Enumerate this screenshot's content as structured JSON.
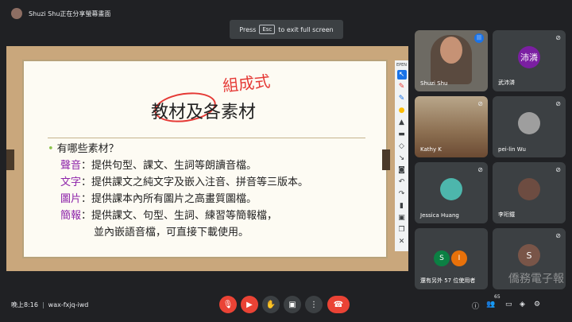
{
  "topbar": {
    "presenting_text": "Shuzi Shu正在分享螢幕畫面"
  },
  "fullscreen_toast": {
    "before": "Press",
    "key": "Esc",
    "after": "to exit full screen"
  },
  "slide": {
    "title": "教材及各素材",
    "handwriting": "組成式",
    "bullet_heading": "有哪些素材？",
    "rows": [
      {
        "term": "聲音",
        "text": "：提供句型、課文、生詞等朗讀音檔。"
      },
      {
        "term": "文字",
        "text": "：提供課文之純文字及嵌入注音、拼音等三版本。"
      },
      {
        "term": "圖片",
        "text": "：提供課本內所有圖片之高畫質圖檔。"
      },
      {
        "term": "簡報",
        "text": "：提供課文、句型、生詞、練習等簡報檔，"
      }
    ],
    "continuation": "並內嵌語音檔，可直接下載使用。"
  },
  "pen_toolbar": {
    "label": "EPEN"
  },
  "participants": [
    {
      "name": "Shuzi Shu",
      "type": "video"
    },
    {
      "name": "武沛潾",
      "avatar_text": "沛潾",
      "avatar_color": "#7b1fa2"
    },
    {
      "name": "Kathy K",
      "type": "video"
    },
    {
      "name": "pei-lin Wu",
      "avatar_text": "",
      "avatar_color": "#9e9e9e"
    },
    {
      "name": "Jessica Huang",
      "avatar_text": "",
      "avatar_color": "#4db6ac"
    },
    {
      "name": "李珩鐵",
      "avatar_text": "",
      "avatar_color": "#6d4c41"
    },
    {
      "name": "還有另外 57 位使用者",
      "avatar_text": "S",
      "avatar_color": "#0b8043",
      "avatar_text2": "I",
      "avatar_color2": "#e8710a"
    },
    {
      "name": "",
      "avatar_text": "S",
      "avatar_color": "#795548"
    }
  ],
  "bottombar": {
    "time": "晚上8:16",
    "meeting_code": "wax-fxjq-iwd",
    "people_count": "65"
  },
  "watermark": "僑務電子報"
}
